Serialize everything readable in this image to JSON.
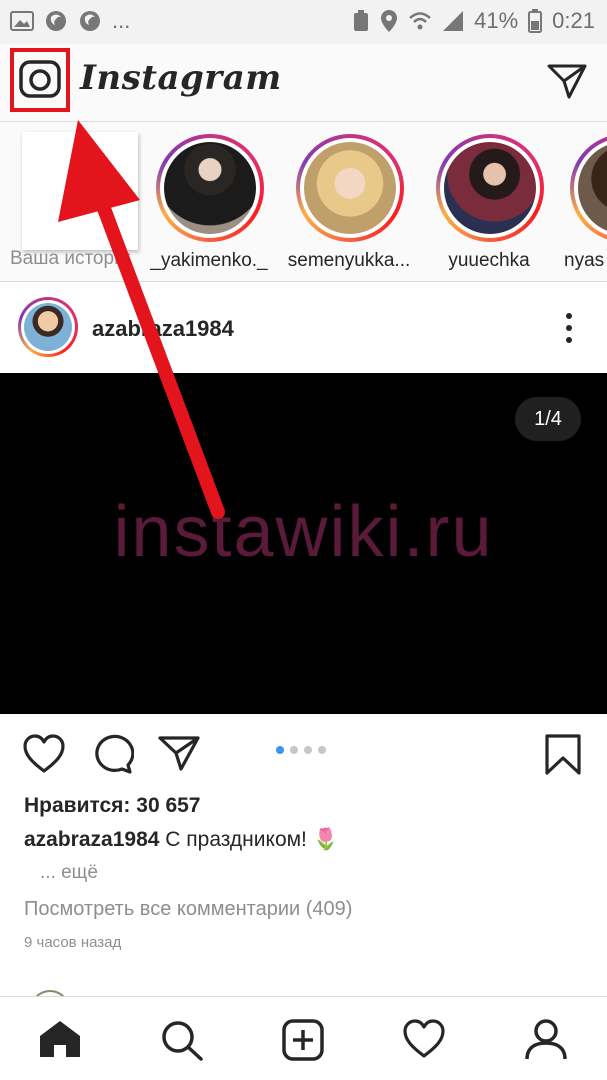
{
  "status_bar": {
    "battery": "41%",
    "time": "0:21",
    "overflow": "..."
  },
  "header": {
    "brand": "Instagram"
  },
  "stories": {
    "my_story_label": "Ваша история",
    "items": [
      {
        "label": "_yakimenko._"
      },
      {
        "label": "semenyukka..."
      },
      {
        "label": "yuuechka"
      },
      {
        "label": "nyas"
      }
    ]
  },
  "post": {
    "username": "azabraza1984",
    "counter": "1/4",
    "watermark": "instawiki.ru",
    "likes": "Нравится: 30 657",
    "caption_user": "azabraza1984",
    "caption_text": " С праздником! 🌷",
    "more": "... ещё",
    "view_comments": "Посмотреть все комментарии (409)",
    "time_ago": "9 часов назад",
    "carousel_total": 4,
    "carousel_active": 1
  },
  "colors": {
    "highlight": "#e3141b",
    "carousel_active": "#3897f0"
  },
  "icons": [
    "camera-icon",
    "direct-message-icon",
    "heart-icon",
    "comment-icon",
    "share-icon",
    "bookmark-icon",
    "home-icon",
    "search-icon",
    "add-post-icon",
    "activity-icon",
    "profile-icon"
  ]
}
